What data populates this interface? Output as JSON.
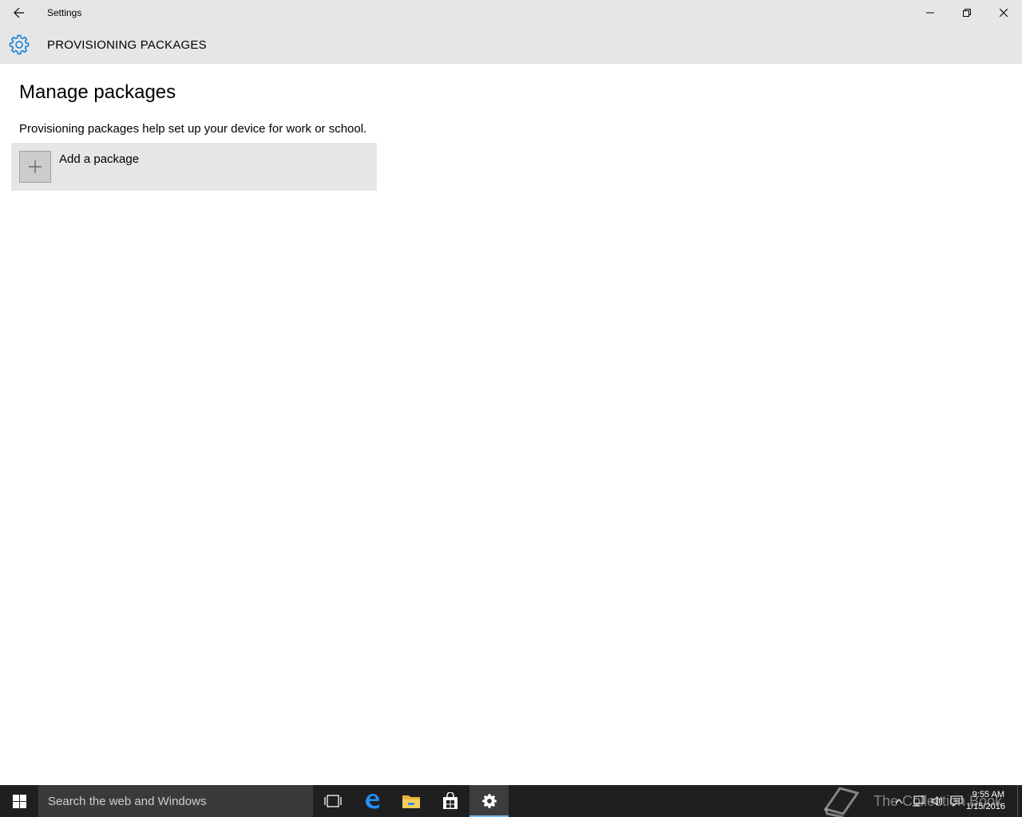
{
  "window": {
    "title": "Settings",
    "header_title": "PROVISIONING PACKAGES"
  },
  "icons": {
    "back": "back-arrow-icon",
    "gear": "gear-icon",
    "minimize": "minimize-icon",
    "restore": "restore-icon",
    "close": "close-icon",
    "plus": "plus-icon"
  },
  "main": {
    "heading": "Manage packages",
    "description": "Provisioning packages help set up your device for work or school.",
    "add_package_label": "Add a package"
  },
  "taskbar": {
    "search_placeholder": "Search the web and Windows",
    "pinned": [
      "task-view-icon",
      "edge-icon",
      "file-explorer-icon",
      "store-icon",
      "settings-icon"
    ],
    "watermark": "The Collection Book",
    "time": "9:55 AM",
    "date": "1/15/2016"
  },
  "colors": {
    "accent": "#0078d7",
    "titlebar_bg": "#e6e6e6",
    "taskbar_bg": "#1f1f1f",
    "search_bg": "#3a3a3a"
  }
}
